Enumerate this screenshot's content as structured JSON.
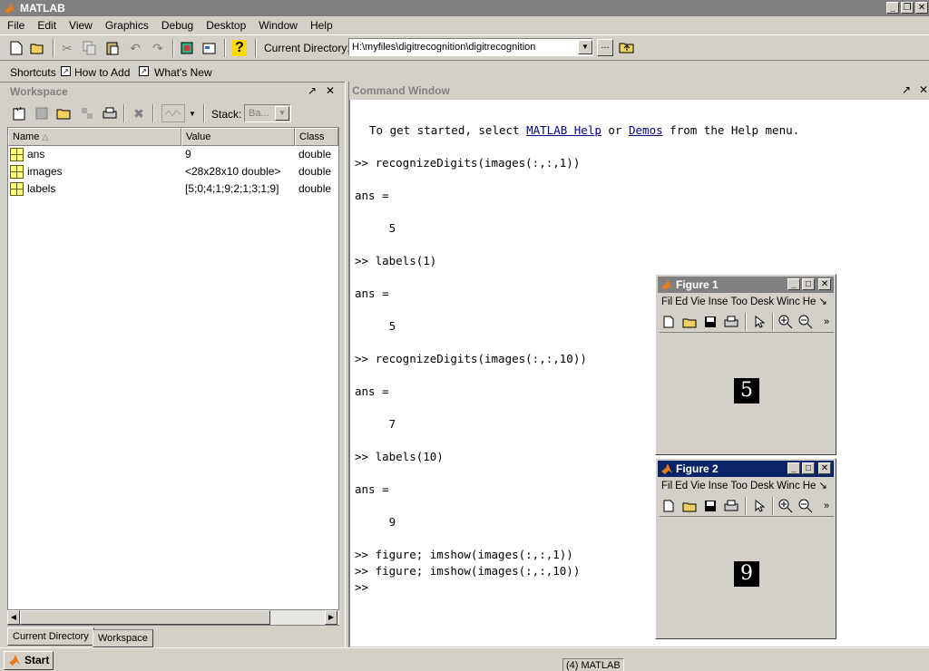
{
  "app": {
    "title": "MATLAB"
  },
  "menu": [
    "File",
    "Edit",
    "View",
    "Graphics",
    "Debug",
    "Desktop",
    "Window",
    "Help"
  ],
  "toolbar": {
    "current_directory_label": "Current Directory:",
    "current_directory_value": "H:\\myfiles\\digitrecognition\\digitrecognition",
    "browse_label": "..."
  },
  "shortcuts": {
    "label": "Shortcuts",
    "items": [
      "How to Add",
      "What's New"
    ]
  },
  "workspace": {
    "title": "Workspace",
    "stack_label": "Stack:",
    "stack_value": "Ba...",
    "columns": [
      "Name",
      "Value",
      "Class"
    ],
    "rows": [
      {
        "name": "ans",
        "value": "9",
        "class": "double"
      },
      {
        "name": "images",
        "value": "<28x28x10 double>",
        "class": "double"
      },
      {
        "name": "labels",
        "value": "[5;0;4;1;9;2;1;3;1;9]",
        "class": "double"
      }
    ],
    "tabs": [
      "Current Directory",
      "Workspace"
    ],
    "active_tab": "Workspace"
  },
  "command_window": {
    "title": "Command Window",
    "intro_prefix": "To get started, select ",
    "intro_link1": "MATLAB Help",
    "intro_mid": " or ",
    "intro_link2": "Demos",
    "intro_suffix": " from the Help menu.",
    "lines": [
      ">> recognizeDigits(images(:,:,1))",
      "ans =",
      "     5",
      ">> labels(1)",
      "ans =",
      "     5",
      ">> recognizeDigits(images(:,:,10))",
      "ans =",
      "     7",
      ">> labels(10)",
      "ans =",
      "     9",
      ">> figure; imshow(images(:,:,1))",
      ">> figure; imshow(images(:,:,10))",
      ">>"
    ]
  },
  "figures": [
    {
      "title": "Figure 1",
      "menu": [
        "Fil",
        "Ed",
        "Vie",
        "Inse",
        "Too",
        "Desk",
        "Winc",
        "He"
      ],
      "digit": "5",
      "active": false
    },
    {
      "title": "Figure 2",
      "menu": [
        "Fil",
        "Ed",
        "Vie",
        "Inse",
        "Too",
        "Desk",
        "Winc",
        "He"
      ],
      "digit": "9",
      "active": true
    }
  ],
  "status": {
    "start_label": "Start",
    "task_label": "(4) MATLAB"
  },
  "colors": {
    "active_title": "#0a246a",
    "inactive_title": "#808080",
    "link": "#00008b"
  }
}
